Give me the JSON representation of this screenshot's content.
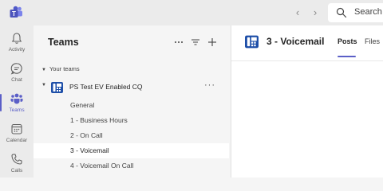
{
  "topbar": {
    "search_placeholder": "Search",
    "back_glyph": "‹",
    "forward_glyph": "›"
  },
  "rail": {
    "items": [
      {
        "label": "Activity",
        "icon": "bell-icon"
      },
      {
        "label": "Chat",
        "icon": "chat-icon"
      },
      {
        "label": "Teams",
        "icon": "teams-icon",
        "active": true
      },
      {
        "label": "Calendar",
        "icon": "calendar-icon"
      },
      {
        "label": "Calls",
        "icon": "phone-icon"
      }
    ]
  },
  "panel": {
    "title": "Teams",
    "section_label": "Your teams",
    "team_name": "PS Test EV Enabled CQ",
    "more_glyph": "···",
    "channels": [
      {
        "label": "General"
      },
      {
        "label": "1 - Business Hours"
      },
      {
        "label": "2 - On Call"
      },
      {
        "label": "3 - Voicemail",
        "selected": true
      },
      {
        "label": "4 - Voicemail On Call"
      }
    ]
  },
  "content": {
    "title": "3 - Voicemail",
    "tabs": [
      {
        "label": "Posts",
        "active": true
      },
      {
        "label": "Files"
      }
    ]
  },
  "colors": {
    "accent": "#5b5fc7",
    "avatar_blue": "#1e4fa8"
  }
}
